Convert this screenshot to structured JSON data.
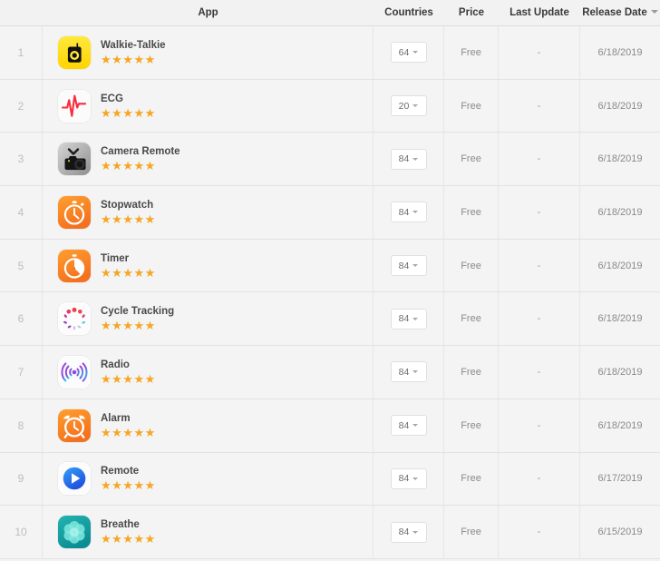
{
  "header": {
    "columns": [
      {
        "key": "rank",
        "label": ""
      },
      {
        "key": "app",
        "label": "App"
      },
      {
        "key": "country",
        "label": "Countries"
      },
      {
        "key": "price",
        "label": "Price"
      },
      {
        "key": "update",
        "label": "Last Update"
      },
      {
        "key": "release",
        "label": "Release Date"
      }
    ],
    "rank_label": "",
    "app_label": "App",
    "countries_label": "Countries",
    "price_label": "Price",
    "last_update_label": "Last Update",
    "release_date_label": "Release Date",
    "sort_indicator": "descending"
  },
  "colors": {
    "page_background": "#f2f2f2",
    "row_background": "#f4f4f4",
    "row_border": "#e2e2e2",
    "star": "#f5a623",
    "header_text": "#3a3a3a",
    "cell_text": "#8a8a8a",
    "rank_text": "#bdbdbd",
    "app_name_text": "#4a4a4a",
    "dropdown_background": "#ffffff",
    "dropdown_border": "#e0e0e0"
  },
  "rows": [
    {
      "rank": "1",
      "app_name": "Walkie-Talkie",
      "icon": "walkie-talkie-icon",
      "rating": 5,
      "stars": "★★★★★",
      "countries": "64",
      "price": "Free",
      "last_update": "-",
      "release_date": "6/18/2019"
    },
    {
      "rank": "2",
      "app_name": "ECG",
      "icon": "ecg-icon",
      "rating": 5,
      "stars": "★★★★★",
      "countries": "20",
      "price": "Free",
      "last_update": "-",
      "release_date": "6/18/2019"
    },
    {
      "rank": "3",
      "app_name": "Camera Remote",
      "icon": "camera-remote-icon",
      "rating": 5,
      "stars": "★★★★★",
      "countries": "84",
      "price": "Free",
      "last_update": "-",
      "release_date": "6/18/2019"
    },
    {
      "rank": "4",
      "app_name": "Stopwatch",
      "icon": "stopwatch-icon",
      "rating": 5,
      "stars": "★★★★★",
      "countries": "84",
      "price": "Free",
      "last_update": "-",
      "release_date": "6/18/2019"
    },
    {
      "rank": "5",
      "app_name": "Timer",
      "icon": "timer-icon",
      "rating": 5,
      "stars": "★★★★★",
      "countries": "84",
      "price": "Free",
      "last_update": "-",
      "release_date": "6/18/2019"
    },
    {
      "rank": "6",
      "app_name": "Cycle Tracking",
      "icon": "cycle-tracking-icon",
      "rating": 5,
      "stars": "★★★★★",
      "countries": "84",
      "price": "Free",
      "last_update": "-",
      "release_date": "6/18/2019"
    },
    {
      "rank": "7",
      "app_name": "Radio",
      "icon": "radio-icon",
      "rating": 5,
      "stars": "★★★★★",
      "countries": "84",
      "price": "Free",
      "last_update": "-",
      "release_date": "6/18/2019"
    },
    {
      "rank": "8",
      "app_name": "Alarm",
      "icon": "alarm-icon",
      "rating": 5,
      "stars": "★★★★★",
      "countries": "84",
      "price": "Free",
      "last_update": "-",
      "release_date": "6/18/2019"
    },
    {
      "rank": "9",
      "app_name": "Remote",
      "icon": "remote-icon",
      "rating": 5,
      "stars": "★★★★★",
      "countries": "84",
      "price": "Free",
      "last_update": "-",
      "release_date": "6/17/2019"
    },
    {
      "rank": "10",
      "app_name": "Breathe",
      "icon": "breathe-icon",
      "rating": 5,
      "stars": "★★★★★",
      "countries": "84",
      "price": "Free",
      "last_update": "-",
      "release_date": "6/15/2019"
    }
  ]
}
